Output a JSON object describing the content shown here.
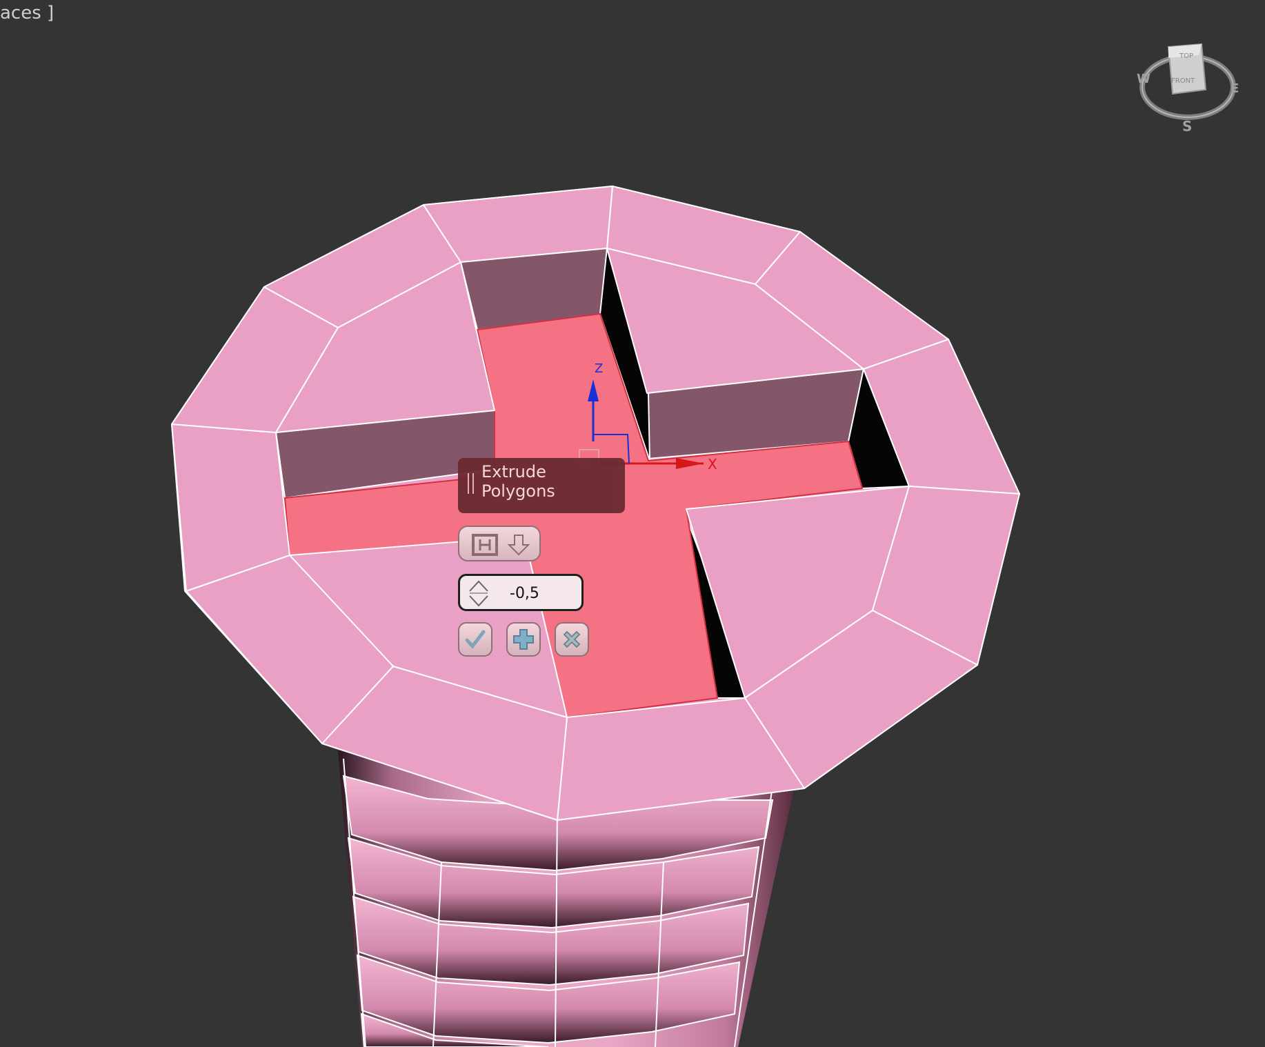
{
  "viewport": {
    "label": "aces ]"
  },
  "gizmo": {
    "x_axis": "X",
    "z_axis": "Z"
  },
  "viewcube": {
    "face_top": "TOP",
    "face_front": "FRONT",
    "west": "W",
    "east": "E",
    "south": "S"
  },
  "caddy": {
    "title": "Extrude Polygons",
    "extrude_type_icon": "group-extrude-icon",
    "height_value": "-0,5",
    "ok_icon": "check-icon",
    "apply_icon": "plus-icon",
    "cancel_icon": "x-icon"
  },
  "colors": {
    "background": "#343434",
    "mesh_pink": "#eaa0c4",
    "selected_red": "#f57184",
    "inner_wall": "#84566a",
    "wire": "#ffffff"
  }
}
